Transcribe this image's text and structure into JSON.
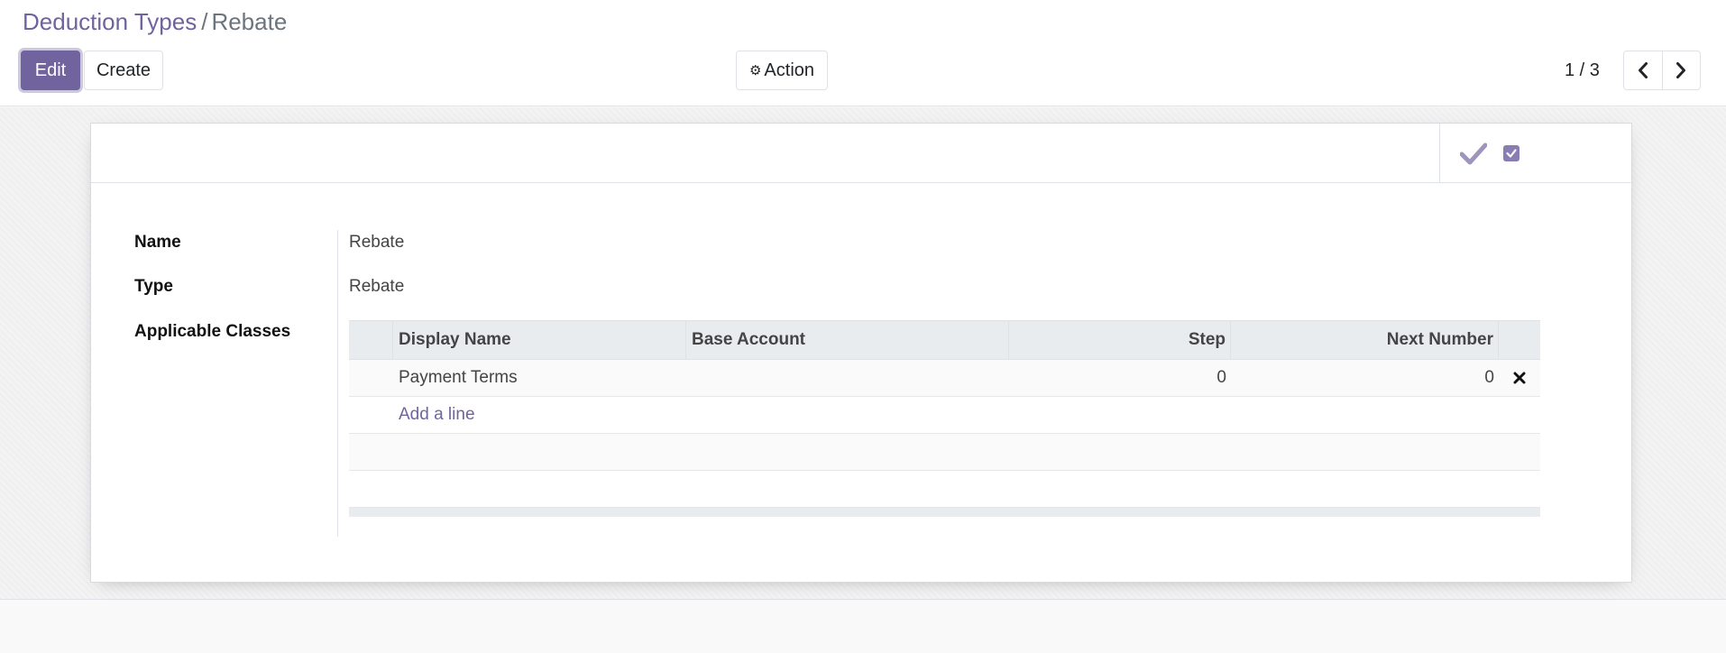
{
  "breadcrumb": {
    "parent": "Deduction Types",
    "separator": "/",
    "current": "Rebate"
  },
  "toolbar": {
    "edit_label": "Edit",
    "create_label": "Create",
    "action_label": "Action",
    "action_icon": "gear-icon"
  },
  "pager": {
    "value": "1 / 3",
    "prev_icon": "chevron-left-icon",
    "next_icon": "chevron-right-icon"
  },
  "statusbar": {
    "icons": [
      "check-icon",
      "checkbox-icon"
    ],
    "accent_color": "#71639e"
  },
  "form": {
    "fields": [
      {
        "label": "Name",
        "value": "Rebate"
      },
      {
        "label": "Type",
        "value": "Rebate"
      },
      {
        "label": "Applicable Classes",
        "value": ""
      }
    ],
    "classes_table": {
      "columns": [
        "Display Name",
        "Base Account",
        "Step",
        "Next Number"
      ],
      "rows": [
        {
          "display_name": "Payment Terms",
          "base_account": "",
          "step": "0",
          "next_number": "0"
        }
      ],
      "add_line_label": "Add a line",
      "delete_icon": "close-icon"
    }
  },
  "colors": {
    "brand": "#71639e",
    "text": "#212529",
    "muted": "#6c757d"
  }
}
